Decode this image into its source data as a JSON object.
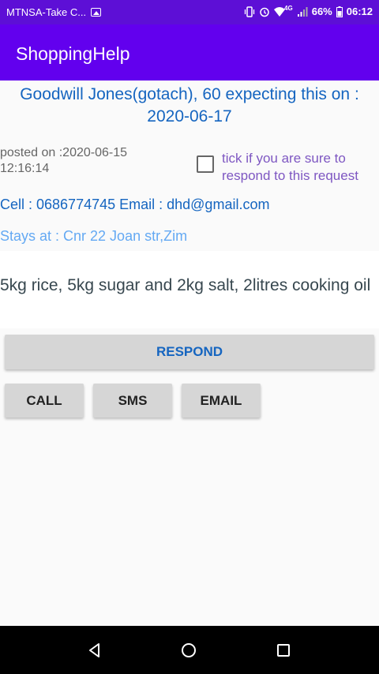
{
  "status_bar": {
    "carrier": "MTNSA-Take C...",
    "network": "4G",
    "battery": "66%",
    "time": "06:12"
  },
  "app_bar": {
    "title": "ShoppingHelp"
  },
  "request": {
    "header": "Goodwill Jones(gotach), 60 expecting this on : 2020-06-17",
    "posted": "posted on :2020-06-15 12:16:14",
    "checkbox_label": "tick if you are sure to respond to this request",
    "checkbox_checked": false,
    "contact": "Cell : 0686774745 Email : dhd@gmail.com",
    "address": "Stays at : Cnr 22 Joan str,Zim",
    "items": "5kg rice, 5kg sugar and 2kg salt, 2litres cooking oil"
  },
  "buttons": {
    "respond": "RESPOND",
    "call": "CALL",
    "sms": "SMS",
    "email": "EMAIL"
  },
  "colors": {
    "status_bar": "#5d0fd6",
    "app_bar": "#6200ee",
    "header_text": "#1565c0",
    "checkbox_text": "#7e57c2",
    "address_text": "#64a9f3"
  },
  "icons": [
    "image-icon",
    "vibrate-icon",
    "alarm-icon",
    "wifi-icon",
    "signal-icon",
    "battery-icon",
    "back-icon",
    "home-icon",
    "recents-icon"
  ]
}
